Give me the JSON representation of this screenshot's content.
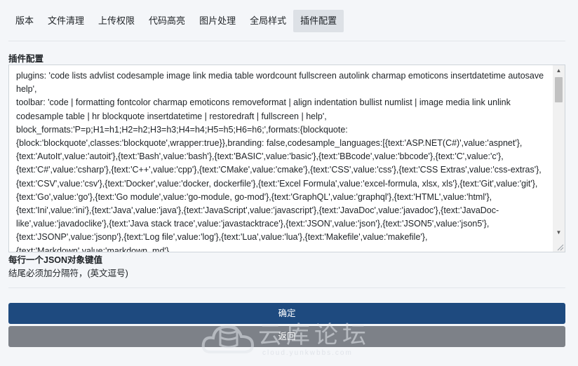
{
  "tabs": [
    {
      "label": "版本"
    },
    {
      "label": "文件清理"
    },
    {
      "label": "上传权限"
    },
    {
      "label": "代码高亮"
    },
    {
      "label": "图片处理"
    },
    {
      "label": "全局样式"
    },
    {
      "label": "插件配置",
      "active": true
    }
  ],
  "plugin_config": {
    "label": "插件配置",
    "value": "plugins: 'code lists advlist codesample image link media table wordcount fullscreen autolink charmap emoticons insertdatetime autosave help',\ntoolbar: 'code | formatting fontcolor charmap emoticons removeformat | align indentation bullist numlist | image media link unlink codesample table | hr blockquote insertdatetime | restoredraft | fullscreen | help',\nblock_formats:'P=p;H1=h1;H2=h2;H3=h3;H4=h4;H5=h5;H6=h6;',formats:{blockquote:{block:'blockquote',classes:'blockquote',wrapper:true}},branding: false,codesample_languages:[{text:'ASP.NET(C#)',value:'aspnet'},{text:'AutoIt',value:'autoit'},{text:'Bash',value:'bash'},{text:'BASIC',value:'basic'},{text:'BBcode',value:'bbcode'},{text:'C',value:'c'},{text:'C#',value:'csharp'},{text:'C++',value:'cpp'},{text:'CMake',value:'cmake'},{text:'CSS',value:'css'},{text:'CSS Extras',value:'css-extras'},{text:'CSV',value:'csv'},{text:'Docker',value:'docker, dockerfile'},{text:'Excel Formula',value:'excel-formula, xlsx, xls'},{text:'Git',value:'git'},{text:'Go',value:'go'},{text:'Go module',value:'go-module, go-mod'},{text:'GraphQL',value:'graphql'},{text:'HTML',value:'html'},{text:'Ini',value:'ini'},{text:'Java',value:'java'},{text:'JavaScript',value:'javascript'},{text:'JavaDoc',value:'javadoc'},{text:'JavaDoc-like',value:'javadoclike'},{text:'Java stack trace',value:'javastacktrace'},{text:'JSON',value:'json'},{text:'JSON5',value:'json5'},{text:'JSONP',value:'jsonp'},{text:'Log file',value:'log'},{text:'Lua',value:'lua'},{text:'Makefile',value:'makefile'},{text:'Markdown',value:'markdown, md'},"
  },
  "help": {
    "line1": "每行一个JSON对象键值",
    "line2": "结尾必须加分隔符，(英文逗号)"
  },
  "buttons": {
    "confirm": "确定",
    "back": "返回"
  },
  "watermark": {
    "title": "云库论坛",
    "subtitle": "cloud.yunkwbbs.com"
  },
  "colors": {
    "confirm_bg": "#1e4a7f",
    "back_bg": "#7d8188",
    "active_tab_bg": "#dde1e6"
  }
}
